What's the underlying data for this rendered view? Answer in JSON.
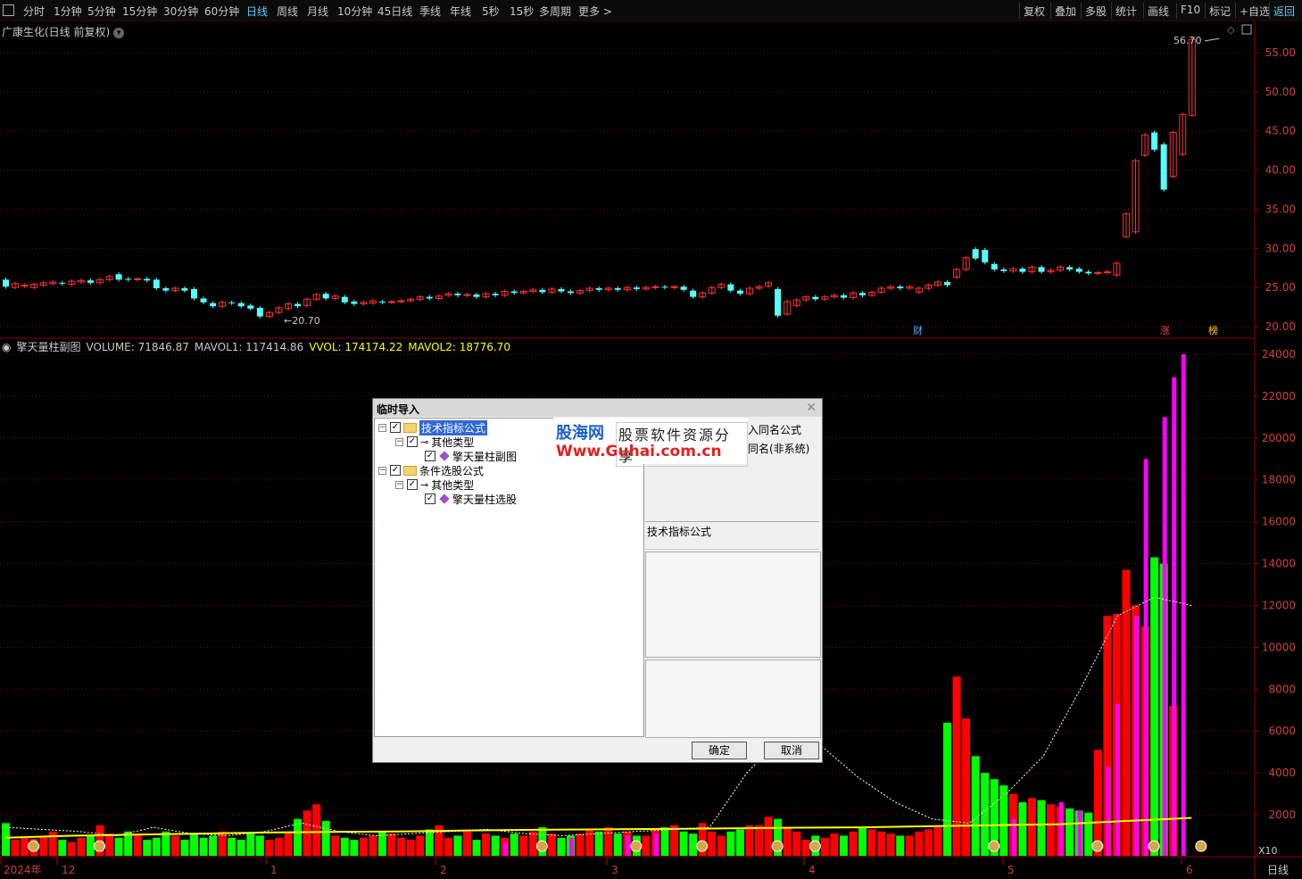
{
  "toolbar": {
    "periods": [
      "分时",
      "1分钟",
      "5分钟",
      "15分钟",
      "30分钟",
      "60分钟",
      "日线",
      "周线",
      "月线",
      "10分钟",
      "45日线",
      "季线",
      "年线",
      "5秒",
      "15秒",
      "多周期",
      "更多 >"
    ],
    "active": "日线",
    "right_buttons": [
      "复权",
      "叠加",
      "多股",
      "统计",
      "画线",
      "F10",
      "标记",
      "+自选",
      "返回"
    ]
  },
  "main_chart": {
    "title": "广康生化(日线 前复权)",
    "y_ticks": [
      "55.00",
      "50.00",
      "45.00",
      "40.00",
      "35.00",
      "30.00",
      "25.00",
      "20.00"
    ],
    "high_label": "56.70",
    "low_label": "20.70",
    "markers": [
      "财",
      "涨",
      "榜"
    ]
  },
  "sub_chart": {
    "name": "擎天量柱副图",
    "volume": "VOLUME: 71846.87",
    "mavol1": "MAVOL1: 117414.86",
    "vvol": "VVOL: 174174.22",
    "mavol2": "MAVOL2: 18776.70",
    "y_ticks": [
      "24000",
      "22000",
      "20000",
      "18000",
      "16000",
      "14000",
      "12000",
      "10000",
      "8000",
      "6000",
      "4000",
      "2000"
    ],
    "scale_label": "X10"
  },
  "x_axis": {
    "labels": [
      "2024年",
      "12",
      "1",
      "2",
      "3",
      "4",
      "5",
      "6"
    ],
    "period_label": "日线"
  },
  "colors": {
    "up": "#ff3030",
    "down": "#54ffff",
    "vol_green": "#00ff00",
    "vol_red": "#ff0000",
    "vol_magenta": "#ff00ff",
    "ma_yellow": "#ffff00"
  },
  "chart_data": {
    "type": "candlestick",
    "ylim": [
      20,
      57
    ],
    "candles": [
      {
        "o": 26.0,
        "c": 25.1
      },
      {
        "o": 25.0,
        "c": 25.5
      },
      {
        "o": 25.2,
        "c": 25.3
      },
      {
        "o": 25.0,
        "c": 25.4
      },
      {
        "o": 25.3,
        "c": 25.6
      },
      {
        "o": 25.5,
        "c": 25.7
      },
      {
        "o": 25.6,
        "c": 25.5
      },
      {
        "o": 25.4,
        "c": 25.8
      },
      {
        "o": 25.7,
        "c": 25.9
      },
      {
        "o": 25.9,
        "c": 25.6
      },
      {
        "o": 25.6,
        "c": 26.0
      },
      {
        "o": 26.0,
        "c": 26.4
      },
      {
        "o": 26.7,
        "c": 26.0
      },
      {
        "o": 26.1,
        "c": 26.0
      },
      {
        "o": 26.0,
        "c": 26.1
      },
      {
        "o": 26.1,
        "c": 25.9
      },
      {
        "o": 26.0,
        "c": 24.9
      },
      {
        "o": 24.9,
        "c": 24.6
      },
      {
        "o": 24.6,
        "c": 24.9
      },
      {
        "o": 24.9,
        "c": 24.6
      },
      {
        "o": 24.8,
        "c": 23.6
      },
      {
        "o": 23.6,
        "c": 23.1
      },
      {
        "o": 23.0,
        "c": 22.6
      },
      {
        "o": 22.6,
        "c": 23.1
      },
      {
        "o": 23.1,
        "c": 23.0
      },
      {
        "o": 23.0,
        "c": 22.6
      },
      {
        "o": 22.7,
        "c": 22.3
      },
      {
        "o": 22.4,
        "c": 21.3
      },
      {
        "o": 21.3,
        "c": 21.8
      },
      {
        "o": 21.8,
        "c": 22.4
      },
      {
        "o": 22.3,
        "c": 22.9
      },
      {
        "o": 22.9,
        "c": 22.6
      },
      {
        "o": 22.7,
        "c": 23.5
      },
      {
        "o": 23.5,
        "c": 24.1
      },
      {
        "o": 24.2,
        "c": 23.6
      },
      {
        "o": 23.6,
        "c": 23.9
      },
      {
        "o": 23.8,
        "c": 23.1
      },
      {
        "o": 23.2,
        "c": 22.9
      },
      {
        "o": 22.9,
        "c": 23.1
      },
      {
        "o": 23.0,
        "c": 23.3
      },
      {
        "o": 23.2,
        "c": 23.1
      },
      {
        "o": 23.1,
        "c": 23.2
      },
      {
        "o": 23.2,
        "c": 23.3
      },
      {
        "o": 23.3,
        "c": 23.5
      },
      {
        "o": 23.5,
        "c": 23.8
      },
      {
        "o": 23.8,
        "c": 23.6
      },
      {
        "o": 23.6,
        "c": 23.9
      },
      {
        "o": 24.0,
        "c": 24.2
      },
      {
        "o": 24.2,
        "c": 24.0
      },
      {
        "o": 24.0,
        "c": 24.1
      },
      {
        "o": 24.1,
        "c": 23.8
      },
      {
        "o": 23.8,
        "c": 24.2
      },
      {
        "o": 24.2,
        "c": 24.0
      },
      {
        "o": 24.0,
        "c": 24.5
      },
      {
        "o": 24.5,
        "c": 24.3
      },
      {
        "o": 24.3,
        "c": 24.5
      },
      {
        "o": 24.5,
        "c": 24.7
      },
      {
        "o": 24.7,
        "c": 24.4
      },
      {
        "o": 24.4,
        "c": 24.8
      },
      {
        "o": 24.8,
        "c": 24.5
      },
      {
        "o": 24.5,
        "c": 24.3
      },
      {
        "o": 24.3,
        "c": 24.6
      },
      {
        "o": 24.6,
        "c": 24.9
      },
      {
        "o": 24.9,
        "c": 24.7
      },
      {
        "o": 24.7,
        "c": 24.9
      },
      {
        "o": 24.9,
        "c": 24.7
      },
      {
        "o": 24.7,
        "c": 25.0
      },
      {
        "o": 25.0,
        "c": 24.8
      },
      {
        "o": 24.8,
        "c": 25.0
      },
      {
        "o": 25.0,
        "c": 25.1
      },
      {
        "o": 25.1,
        "c": 25.0
      },
      {
        "o": 25.0,
        "c": 25.1
      },
      {
        "o": 25.1,
        "c": 24.7
      },
      {
        "o": 24.6,
        "c": 23.8
      },
      {
        "o": 23.8,
        "c": 24.3
      },
      {
        "o": 24.3,
        "c": 25.0
      },
      {
        "o": 25.0,
        "c": 25.4
      },
      {
        "o": 25.4,
        "c": 24.6
      },
      {
        "o": 24.6,
        "c": 24.2
      },
      {
        "o": 24.2,
        "c": 24.9
      },
      {
        "o": 24.9,
        "c": 25.1
      },
      {
        "o": 25.2,
        "c": 25.6
      },
      {
        "o": 24.8,
        "c": 21.4
      },
      {
        "o": 21.6,
        "c": 23.2
      },
      {
        "o": 22.7,
        "c": 23.4
      },
      {
        "o": 23.4,
        "c": 23.8
      },
      {
        "o": 23.8,
        "c": 23.5
      },
      {
        "o": 23.5,
        "c": 23.8
      },
      {
        "o": 23.8,
        "c": 24.0
      },
      {
        "o": 24.0,
        "c": 23.7
      },
      {
        "o": 23.7,
        "c": 24.3
      },
      {
        "o": 24.3,
        "c": 24.0
      },
      {
        "o": 24.0,
        "c": 24.4
      },
      {
        "o": 24.4,
        "c": 24.9
      },
      {
        "o": 24.9,
        "c": 25.1
      },
      {
        "o": 25.1,
        "c": 24.9
      },
      {
        "o": 24.9,
        "c": 25.1
      },
      {
        "o": 24.4,
        "c": 24.9
      },
      {
        "o": 24.9,
        "c": 25.3
      },
      {
        "o": 25.3,
        "c": 25.7
      },
      {
        "o": 25.7,
        "c": 25.3
      },
      {
        "o": 26.3,
        "c": 27.3
      },
      {
        "o": 27.3,
        "c": 28.8
      },
      {
        "o": 29.9,
        "c": 28.7
      },
      {
        "o": 29.8,
        "c": 28.2
      },
      {
        "o": 28.0,
        "c": 27.3
      },
      {
        "o": 27.3,
        "c": 27.1
      },
      {
        "o": 27.1,
        "c": 27.4
      },
      {
        "o": 27.4,
        "c": 27.0
      },
      {
        "o": 27.0,
        "c": 27.6
      },
      {
        "o": 27.6,
        "c": 27.0
      },
      {
        "o": 27.0,
        "c": 27.2
      },
      {
        "o": 27.2,
        "c": 27.6
      },
      {
        "o": 27.6,
        "c": 27.3
      },
      {
        "o": 27.4,
        "c": 27.0
      },
      {
        "o": 27.0,
        "c": 26.8
      },
      {
        "o": 26.8,
        "c": 26.9
      },
      {
        "o": 26.9,
        "c": 27.0
      },
      {
        "o": 26.6,
        "c": 28.1
      },
      {
        "o": 31.5,
        "c": 34.4
      },
      {
        "o": 32.1,
        "c": 41.2
      },
      {
        "o": 41.9,
        "c": 44.5
      },
      {
        "o": 44.8,
        "c": 42.6
      },
      {
        "o": 43.3,
        "c": 37.5
      },
      {
        "o": 39.2,
        "c": 44.8
      },
      {
        "o": 42.0,
        "c": 47.1
      },
      {
        "o": 47.0,
        "c": 56.7
      }
    ],
    "volume": [
      1600,
      800,
      900,
      850,
      1000,
      1200,
      800,
      700,
      900,
      1000,
      1500,
      1100,
      900,
      1200,
      1000,
      800,
      900,
      1200,
      1000,
      800,
      1100,
      900,
      1000,
      1200,
      900,
      800,
      1100,
      1000,
      800,
      900,
      1200,
      1800,
      2200,
      2500,
      1700,
      1000,
      900,
      800,
      900,
      1000,
      1200,
      1100,
      900,
      800,
      1000,
      1300,
      1500,
      900,
      1000,
      1200,
      800,
      1100,
      1000,
      900,
      1100,
      1000,
      1200,
      1400,
      1100,
      900,
      1000,
      1100,
      1300,
      1200,
      1400,
      1100,
      1200,
      1000,
      1000,
      1300,
      1400,
      1500,
      1200,
      1100,
      1600,
      1200,
      1000,
      1200,
      1300,
      1500,
      1500,
      1900,
      1800,
      1400,
      1200,
      800,
      1000,
      900,
      1100,
      1000,
      1200,
      1400,
      1300,
      1200,
      1100,
      1000,
      1000,
      1200,
      1300,
      1400,
      6400,
      8600,
      6600,
      4800,
      4000,
      3700,
      3400,
      3000,
      2600,
      2800,
      2700,
      2500,
      2400,
      2300,
      2200,
      2100,
      5100,
      11500,
      11600,
      13700,
      12000,
      11000,
      14300,
      14000,
      7200
    ],
    "vol_colors": "g",
    "magenta_bars": [
      [
        53,
        700
      ],
      [
        60,
        900
      ],
      [
        66,
        1000
      ],
      [
        69,
        1100
      ],
      [
        107,
        1800
      ],
      [
        112,
        2600
      ],
      [
        114,
        2200
      ],
      [
        117,
        4300
      ],
      [
        118,
        7300
      ],
      [
        120,
        11500
      ],
      [
        121,
        19000
      ],
      [
        123,
        21000
      ],
      [
        124,
        22900
      ],
      [
        125,
        24000
      ]
    ],
    "mavol_yellow": [
      900,
      1000,
      1050,
      1100,
      1150,
      1180,
      1200,
      1250,
      1280,
      1300,
      1320,
      1350,
      1380,
      1400,
      1450,
      1500,
      1550,
      1700,
      1850
    ]
  }
}
